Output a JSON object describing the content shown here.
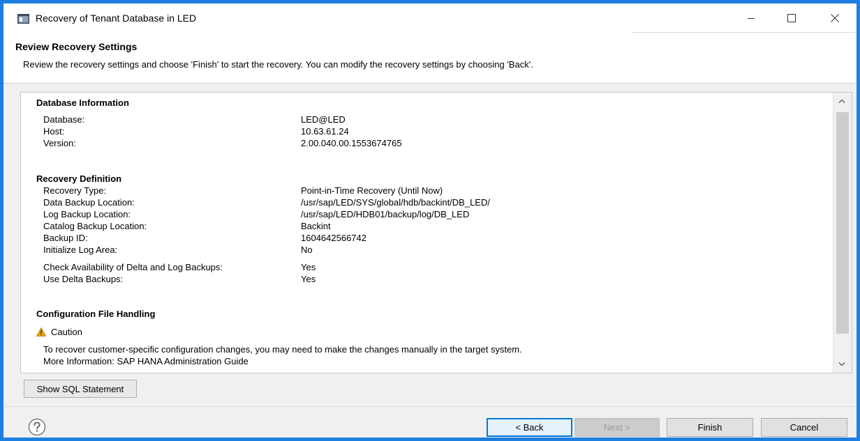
{
  "window": {
    "title": "Recovery of Tenant Database in LED"
  },
  "header": {
    "title": "Review Recovery Settings",
    "description": "Review the recovery settings and choose 'Finish' to start the recovery. You can modify the recovery settings by choosing 'Back'."
  },
  "database_info": {
    "title": "Database Information",
    "rows": [
      {
        "label": "Database:",
        "value": "LED@LED"
      },
      {
        "label": "Host:",
        "value": "10.63.61.24"
      },
      {
        "label": "Version:",
        "value": "2.00.040.00.1553674765"
      }
    ]
  },
  "recovery_definition": {
    "title": "Recovery Definition",
    "rows": [
      {
        "label": "Recovery Type:",
        "value": "Point-in-Time Recovery (Until Now)"
      },
      {
        "label": "Data Backup Location:",
        "value": "/usr/sap/LED/SYS/global/hdb/backint/DB_LED/"
      },
      {
        "label": "Log Backup Location:",
        "value": "/usr/sap/LED/HDB01/backup/log/DB_LED"
      },
      {
        "label": "Catalog Backup Location:",
        "value": "Backint"
      },
      {
        "label": "Backup ID:",
        "value": "1604642566742"
      },
      {
        "label": "Initialize Log Area:",
        "value": "No"
      },
      {
        "label": "Check Availability of Delta and Log Backups:",
        "value": "Yes"
      },
      {
        "label": "Use Delta Backups:",
        "value": "Yes"
      }
    ]
  },
  "config_handling": {
    "title": "Configuration File Handling",
    "caution_label": "Caution",
    "caution_text": "To recover customer-specific configuration changes, you may need to make the changes manually in the target system.",
    "more_info": "More Information: SAP HANA Administration Guide"
  },
  "buttons": {
    "show_sql": "Show SQL Statement",
    "back": "< Back",
    "next": "Next >",
    "finish": "Finish",
    "cancel": "Cancel"
  },
  "icons": {
    "app": "app-window-icon",
    "minimize": "minimize-icon",
    "maximize": "maximize-icon",
    "close": "close-icon",
    "caution": "warning-icon",
    "help": "help-icon"
  },
  "colors": {
    "window_border": "#1f7fe0",
    "caution": "#e8a317",
    "focus": "#0078d7"
  }
}
